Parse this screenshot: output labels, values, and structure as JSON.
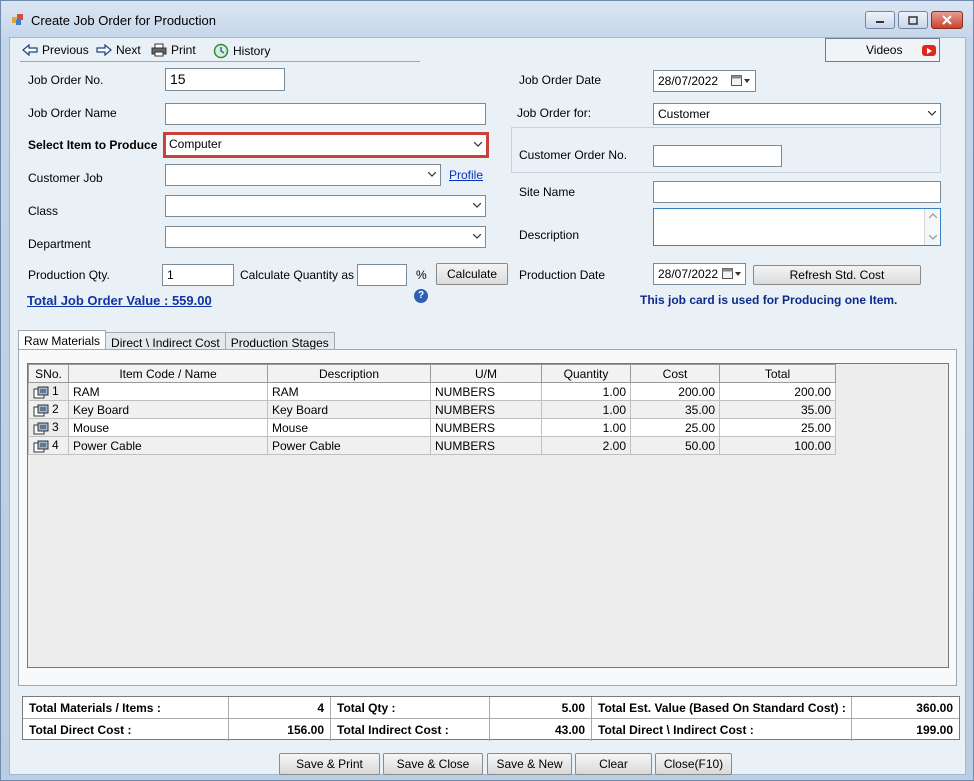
{
  "window": {
    "title": "Create Job Order for Production"
  },
  "toolbar": {
    "previous": "Previous",
    "next": "Next",
    "print": "Print",
    "history": "History",
    "videos": "Videos"
  },
  "form": {
    "job_order_no_label": "Job Order No.",
    "job_order_no": "15",
    "job_order_name_label": "Job Order Name",
    "job_order_name": "",
    "select_item_label": "Select Item to Produce",
    "select_item": "Computer",
    "customer_job_label": "Customer Job",
    "customer_job": "",
    "profile_link": "Profile",
    "class_label": "Class",
    "class": "",
    "department_label": "Department",
    "department": "",
    "production_qty_label": "Production Qty.",
    "production_qty": "1",
    "calc_qty_label": "Calculate Quantity as",
    "calc_qty": "",
    "percent_sign": "%",
    "calculate_button": "Calculate",
    "total_value": "Total Job Order Value : 559.00",
    "job_order_date_label": "Job Order Date",
    "job_order_date": "28/07/2022",
    "job_order_for_label": "Job Order for:",
    "job_order_for": "Customer",
    "customer_order_no_label": "Customer Order No.",
    "customer_order_no": "",
    "site_name_label": "Site Name",
    "site_name": "",
    "description_label": "Description",
    "description": "",
    "production_date_label": "Production Date",
    "production_date": "28/07/2022",
    "refresh_button": "Refresh Std. Cost",
    "note": "This job card is used for Producing one Item."
  },
  "tabs": [
    "Raw Materials",
    "Direct \\ Indirect Cost",
    "Production Stages"
  ],
  "grid": {
    "columns": [
      "SNo.",
      "Item Code / Name",
      "Description",
      "U/M",
      "Quantity",
      "Cost",
      "Total"
    ],
    "rows": [
      [
        "1",
        "RAM",
        "RAM",
        "NUMBERS",
        "1.00",
        "200.00",
        "200.00"
      ],
      [
        "2",
        "Key Board",
        "Key Board",
        "NUMBERS",
        "1.00",
        "35.00",
        "35.00"
      ],
      [
        "3",
        "Mouse",
        "Mouse",
        "NUMBERS",
        "1.00",
        "25.00",
        "25.00"
      ],
      [
        "4",
        "Power Cable",
        "Power Cable",
        "NUMBERS",
        "2.00",
        "50.00",
        "100.00"
      ]
    ]
  },
  "summary": {
    "total_materials_label": "Total Materials / Items :",
    "total_materials": "4",
    "total_qty_label": "Total Qty :",
    "total_qty": "5.00",
    "total_est_label": "Total Est. Value  (Based On Standard Cost) :",
    "total_est": "360.00",
    "total_direct_label": "Total Direct Cost :",
    "total_direct": "156.00",
    "total_indirect_label": "Total Indirect Cost :",
    "total_indirect": "43.00",
    "total_di_label": "Total Direct \\ Indirect Cost  :",
    "total_di": "199.00"
  },
  "buttons": {
    "save_print": "Save & Print",
    "save_close": "Save & Close",
    "save_new": "Save & New",
    "clear": "Clear",
    "close": "Close(F10)"
  }
}
